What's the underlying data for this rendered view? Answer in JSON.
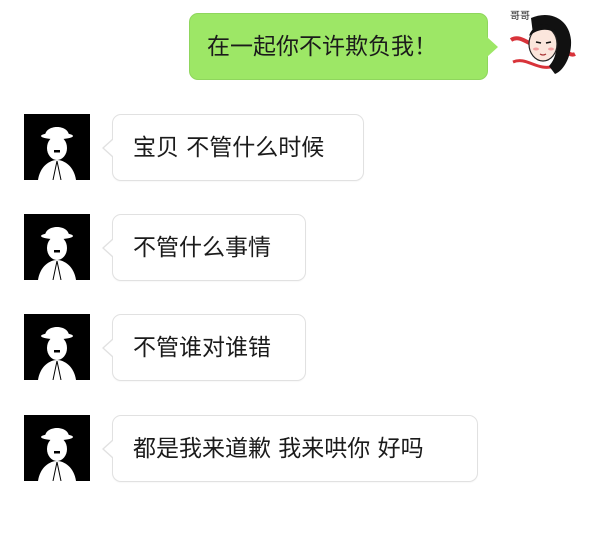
{
  "conversation": {
    "sent_message": "在一起你不许欺负我！",
    "received_messages": [
      "宝贝 不管什么时候",
      "不管什么事情",
      "不管谁对谁错",
      "都是我来道歉 我来哄你 好吗"
    ]
  },
  "avatars": {
    "self_icon": "cartoon-girl-sticker-icon",
    "self_sticker_text": "哥哥",
    "contact_icon": "bowler-hat-man-icon"
  },
  "colors": {
    "sent_bubble": "#9de766",
    "received_bubble": "#ffffff",
    "contact_avatar_background": "#000000"
  }
}
